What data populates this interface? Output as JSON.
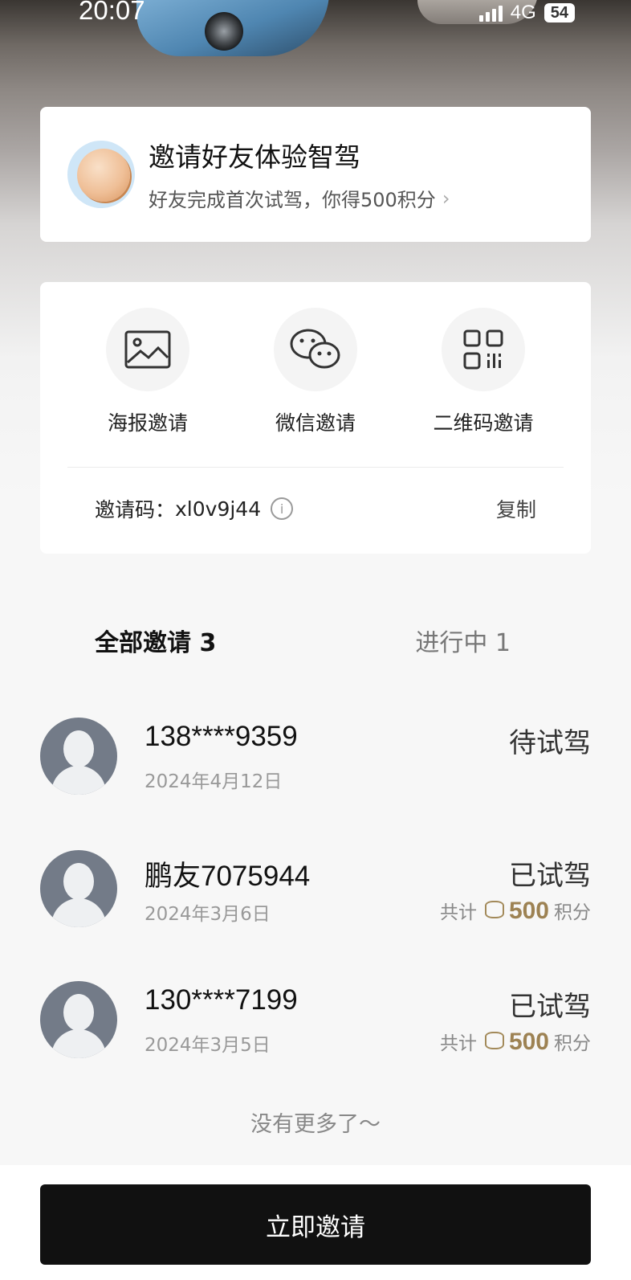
{
  "status_bar": {
    "time": "20:07",
    "network": "4G",
    "battery": "54"
  },
  "hero": {
    "title": "邀请好友体验智驾",
    "subtitle": "好友完成首次试驾，你得500积分",
    "chevron": "›",
    "icon": "coin-icon"
  },
  "invite_options": [
    {
      "label": "海报邀请",
      "icon": "image-icon"
    },
    {
      "label": "微信邀请",
      "icon": "wechat-icon"
    },
    {
      "label": "二维码邀请",
      "icon": "qrcode-icon"
    }
  ],
  "invite_code": {
    "label": "邀请码：",
    "value": "xl0v9j44",
    "info_icon": "i",
    "copy": "复制"
  },
  "tabs": {
    "all": "全部邀请 3",
    "in_progress": "进行中 1"
  },
  "invites": [
    {
      "name": "138****9359",
      "date": "2024年4月12日",
      "status": "待试驾"
    },
    {
      "name": "鹏友7075944",
      "date": "2024年3月6日",
      "status": "已试驾",
      "points_prefix": "共计",
      "points": "500",
      "points_suffix": "积分"
    },
    {
      "name": "130****7199",
      "date": "2024年3月5日",
      "status": "已试驾",
      "points_prefix": "共计",
      "points": "500",
      "points_suffix": "积分"
    }
  ],
  "footer_text": "没有更多了～",
  "cta": "立即邀请",
  "colors": {
    "accent_gold": "#9d8253",
    "button_bg": "#111111"
  }
}
